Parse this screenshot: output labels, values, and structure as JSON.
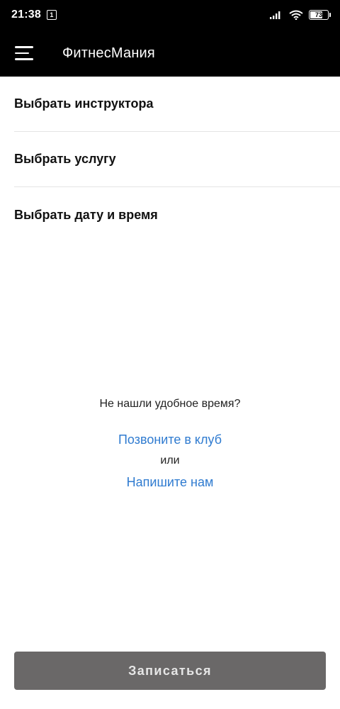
{
  "status_bar": {
    "time": "21:38",
    "notification_badge": "1",
    "battery_level": "73",
    "battery_fraction": 0.73,
    "icons": [
      "signal-icon",
      "wifi-icon",
      "battery-icon"
    ]
  },
  "app_bar": {
    "title": "ФитнесМания",
    "menu_icon": "hamburger-menu-icon"
  },
  "menu": {
    "items": [
      {
        "label": "Выбрать инструктора"
      },
      {
        "label": "Выбрать услугу"
      },
      {
        "label": "Выбрать дату и время"
      }
    ]
  },
  "help": {
    "question": "Не нашли удобное время?",
    "call_link": "Позвоните в клуб",
    "or_text": "или",
    "write_link": "Напишите нам"
  },
  "submit": {
    "label": "Записаться"
  },
  "colors": {
    "app_bar_bg": "#000000",
    "link": "#2f7bd0",
    "submit_bg": "#6a6868",
    "submit_text": "#e6e6e6"
  }
}
